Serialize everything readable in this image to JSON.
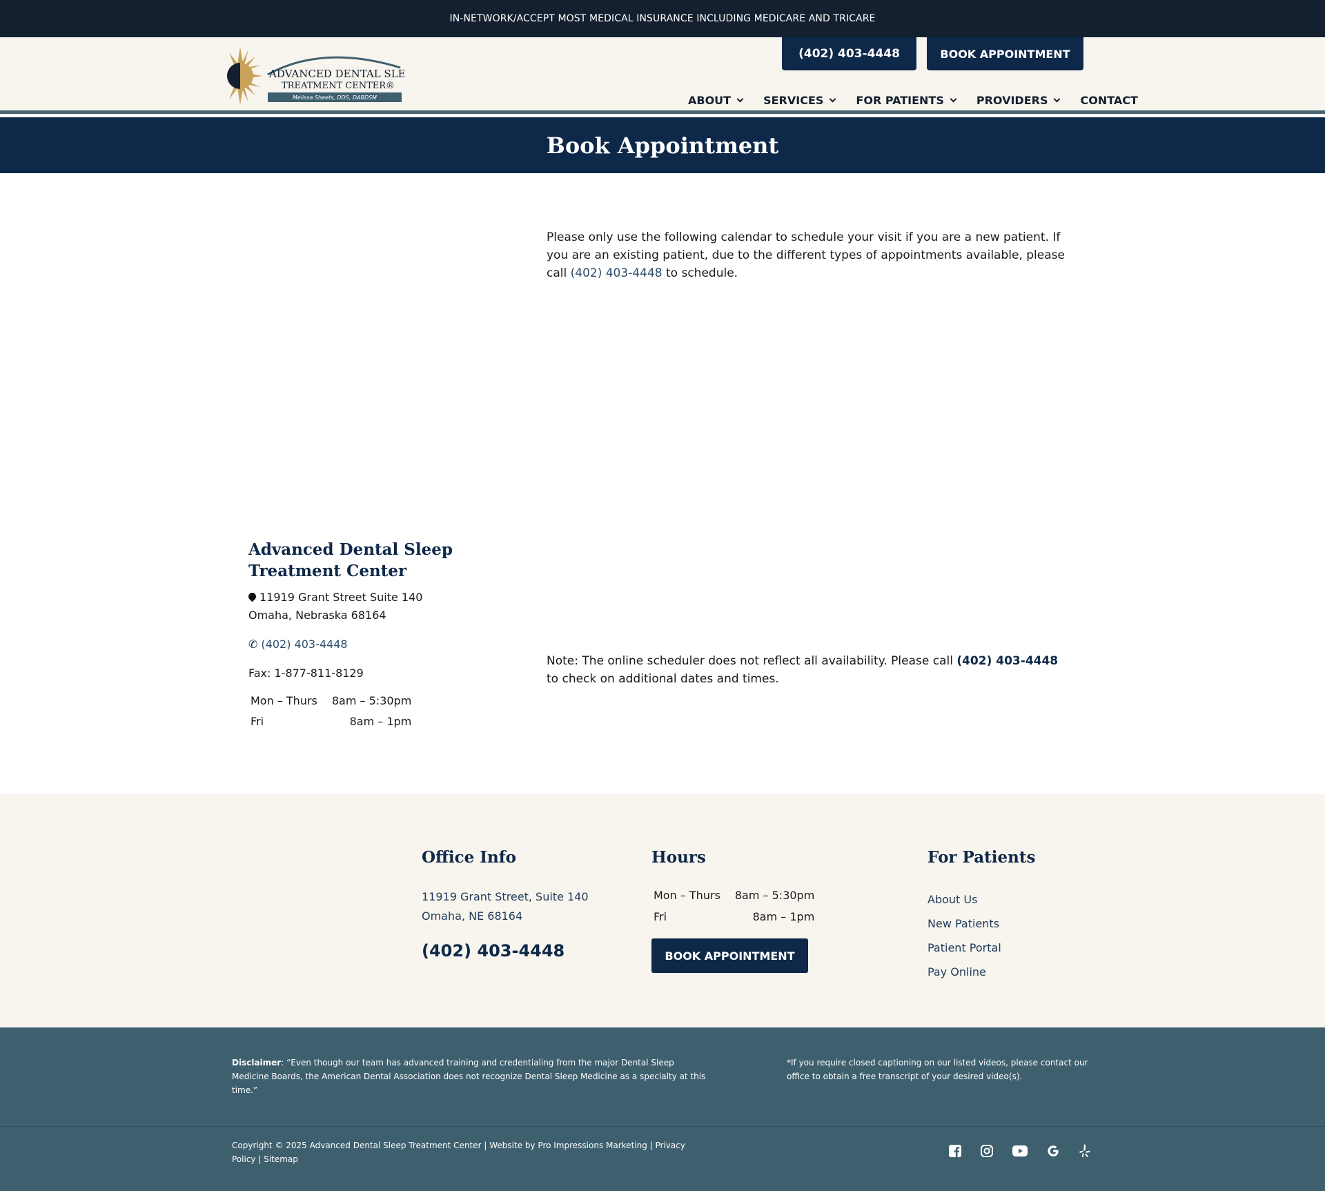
{
  "topbar": {
    "text": "IN-NETWORK/ACCEPT MOST MEDICAL INSURANCE INCLUDING MEDICARE AND TRICARE"
  },
  "header": {
    "logo_line1": "ADVANCED DENTAL SLEEP",
    "logo_line2": "TREATMENT CENTER®",
    "logo_line3": "Melissa Sheets, DDS, DABDSM",
    "phone_button": "(402) 403-4448",
    "book_button": "BOOK APPOINTMENT",
    "nav": [
      {
        "label": "ABOUT"
      },
      {
        "label": "SERVICES"
      },
      {
        "label": "FOR PATIENTS"
      },
      {
        "label": "PROVIDERS"
      },
      {
        "label": "CONTACT"
      }
    ]
  },
  "banner": {
    "title": "Book Appointment"
  },
  "main": {
    "intro_text": "Please only use the following calendar to schedule your  visit if you are a new patient. If you are an existing patient, due to the different types of appointments available, please call ",
    "intro_phone": "(402) 403-4448",
    "intro_end": " to schedule.",
    "note_text": "Note: The online scheduler does not reflect all availability. Please call ",
    "note_phone": "(402) 403-4448",
    "note_end": " to check on additional dates and times."
  },
  "office": {
    "name": "Advanced Dental Sleep Treatment Center",
    "address1": "11919 Grant Street Suite 140",
    "address2": "Omaha, Nebraska 68164",
    "phone": "(402) 403-4448",
    "fax": "Fax: 1-877-811-8129",
    "hours": [
      {
        "day": "Mon – Thurs",
        "time": "8am – 5:30pm"
      },
      {
        "day": "Fri",
        "time": "8am – 1pm"
      }
    ]
  },
  "footer": {
    "office_title": "Office Info",
    "office_addr1": "11919 Grant Street, Suite 140",
    "office_addr2": "Omaha, NE 68164",
    "office_phone": "(402) 403-4448",
    "hours_title": "Hours",
    "hours": [
      {
        "day": "Mon – Thurs",
        "time": "8am – 5:30pm"
      },
      {
        "day": "Fri",
        "time": "8am – 1pm"
      }
    ],
    "book_button": "BOOK APPOINTMENT",
    "patients_title": "For Patients",
    "patient_links": [
      {
        "label": "About Us"
      },
      {
        "label": "New Patients"
      },
      {
        "label": "Patient Portal"
      },
      {
        "label": "Pay Online"
      }
    ],
    "disclaimer_label": "Disclaimer",
    "disclaimer_text": ": “Even though our team has advanced training and credentialing from the major Dental Sleep Medicine Boards, the American Dental Association does not recognize Dental Sleep Medicine as a specialty at this time.”",
    "caption_text": "*If you require closed captioning on our listed videos, please contact our office to obtain a free transcript of your desired video(s).",
    "copyright_text": "Copyright © 2025 Advanced Dental Sleep Treatment Center | ",
    "website_by": "Website by Pro Impressions Marketing",
    "sep": " | ",
    "privacy": "Privacy Policy",
    "sitemap": "Sitemap",
    "social": [
      "facebook-icon",
      "instagram-icon",
      "youtube-icon",
      "google-icon",
      "yelp-icon"
    ]
  },
  "colors": {
    "navy": "#0e2849",
    "dark": "#14202f",
    "cream": "#f8f5ee",
    "slate": "#3e5f6e",
    "gold": "#c9a25c"
  }
}
